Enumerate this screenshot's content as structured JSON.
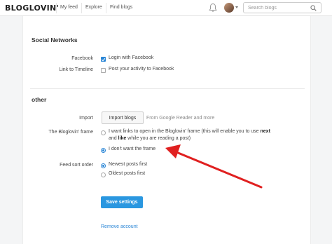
{
  "header": {
    "logo": "BLOGLOVIN'",
    "nav": [
      "My feed",
      "Explore",
      "Find blogs"
    ],
    "search_placeholder": "Search blogs"
  },
  "social": {
    "title": "Social Networks",
    "facebook_label": "Facebook",
    "facebook_option": "Login with Facebook",
    "facebook_checked": true,
    "timeline_label": "Link to Timeline",
    "timeline_option": "Post your activity to Facebook",
    "timeline_checked": false
  },
  "other": {
    "title": "other",
    "import_label": "Import",
    "import_button": "Import blogs",
    "import_hint": "From Google Reader and more",
    "frame_label": "The Bloglovin' frame",
    "frame_option1_a": "I want links to open in the Bloglovin' frame (this will enable you to use ",
    "frame_option1_next": "next",
    "frame_option1_b": "and ",
    "frame_option1_like": "like",
    "frame_option1_c": " while you are reading a post)",
    "frame_option2": "I don't want the frame",
    "frame_selected": 2,
    "sort_label": "Feed sort order",
    "sort_option1": "Newest posts first",
    "sort_option2": "Oldest posts first",
    "sort_selected": 1
  },
  "actions": {
    "save_button": "Save settings",
    "remove_link": "Remove account"
  },
  "colors": {
    "accent": "#2a86d6",
    "annotation_arrow": "#e02020"
  }
}
